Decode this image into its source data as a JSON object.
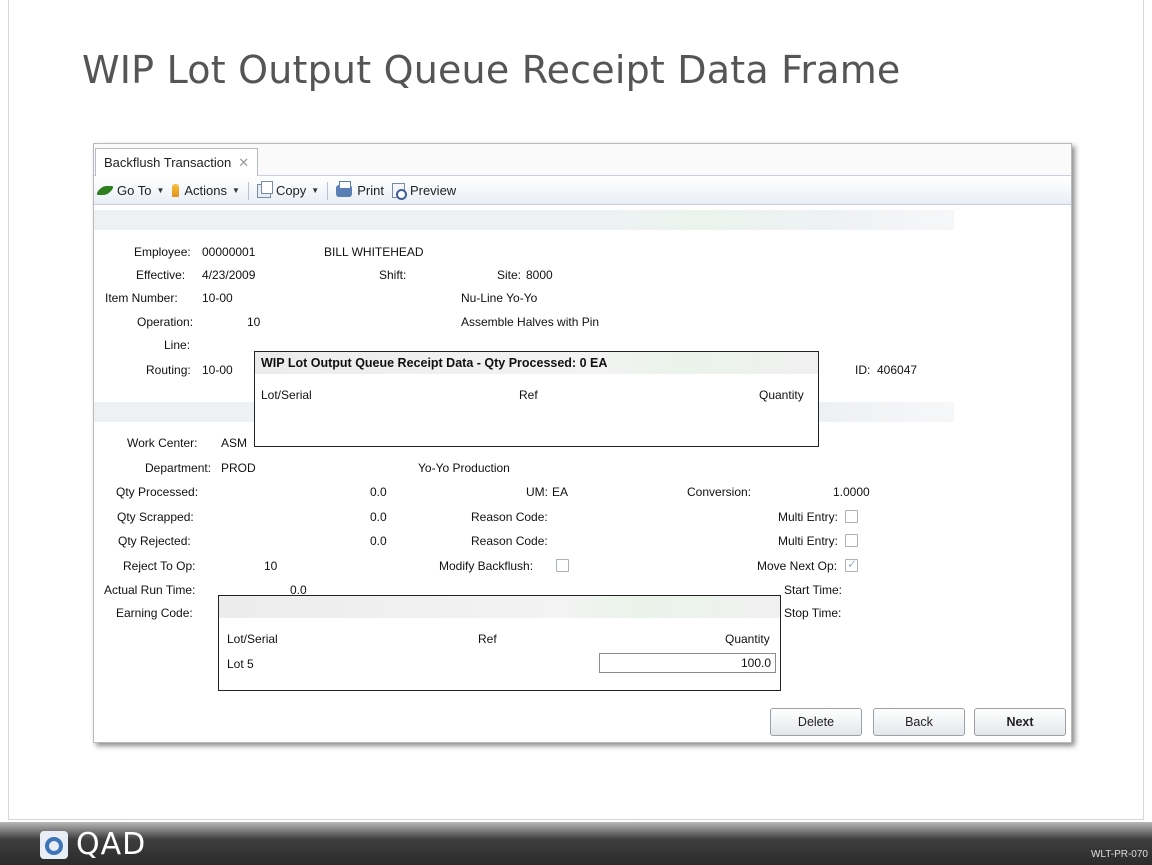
{
  "slide": {
    "title": "WIP Lot Output Queue Receipt Data Frame",
    "code": "WLT-PR-070",
    "logo_text": "QAD"
  },
  "tab": {
    "label": "Backflush Transaction",
    "close_icon": "close-icon"
  },
  "toolbar": {
    "goto": "Go To",
    "actions": "Actions",
    "copy": "Copy",
    "print": "Print",
    "preview": "Preview"
  },
  "form": {
    "employee_label": "Employee:",
    "employee_value": "00000001",
    "employee_name": "BILL WHITEHEAD",
    "effective_label": "Effective:",
    "effective_value": "4/23/2009",
    "shift_label": "Shift:",
    "site_label": "Site:",
    "site_value": "8000",
    "item_label": "Item Number:",
    "item_value": "10-00",
    "item_desc": "Nu-Line Yo-Yo",
    "operation_label": "Operation:",
    "operation_value": "10",
    "operation_desc": "Assemble Halves with Pin",
    "line_label": "Line:",
    "routing_label": "Routing:",
    "routing_value": "10-00",
    "id_label": "ID:",
    "id_value": "406047",
    "workcenter_label": "Work Center:",
    "workcenter_value": "ASM",
    "department_label": "Department:",
    "department_value": "PROD",
    "department_desc": "Yo-Yo Production",
    "qty_processed_label": "Qty Processed:",
    "qty_processed_value": "0.0",
    "um_label": "UM:",
    "um_value": "EA",
    "conversion_label": "Conversion:",
    "conversion_value": "1.0000",
    "qty_scrapped_label": "Qty Scrapped:",
    "qty_scrapped_value": "0.0",
    "reason_code_label_1": "Reason Code:",
    "multi_entry_label_1": "Multi Entry:",
    "qty_rejected_label": "Qty Rejected:",
    "qty_rejected_value": "0.0",
    "reason_code_label_2": "Reason Code:",
    "multi_entry_label_2": "Multi Entry:",
    "reject_to_op_label": "Reject To Op:",
    "reject_to_op_value": "10",
    "modify_backflush_label": "Modify Backflush:",
    "move_next_op_label": "Move Next Op:",
    "actual_run_time_label": "Actual Run Time:",
    "actual_run_time_value": "0.0",
    "start_time_label": "Start Time:",
    "earning_code_label": "Earning Code:",
    "stop_time_label": "Stop Time:",
    "modify_backflush_checked": false,
    "multi_entry_1_checked": false,
    "multi_entry_2_checked": false,
    "move_next_op_checked": true
  },
  "popup_top": {
    "title": "WIP Lot Output Queue Receipt Data - Qty Processed: 0 EA",
    "col_lot": "Lot/Serial",
    "col_ref": "Ref",
    "col_qty": "Quantity"
  },
  "popup_bottom": {
    "col_lot": "Lot/Serial",
    "col_ref": "Ref",
    "col_qty": "Quantity",
    "row_lot": "Lot 5",
    "row_qty": "100.0"
  },
  "buttons": {
    "delete": "Delete",
    "back": "Back",
    "next": "Next"
  }
}
